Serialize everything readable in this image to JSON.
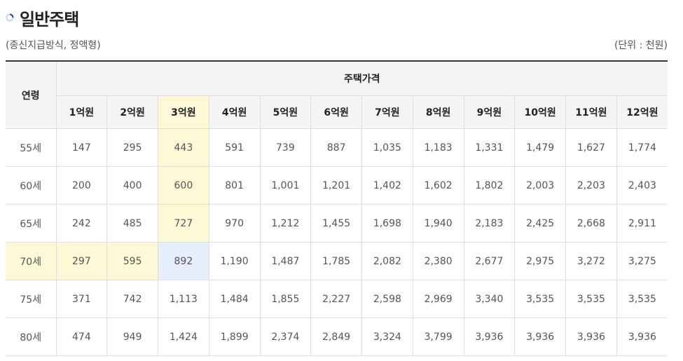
{
  "title": "일반주택",
  "subtitle_left": "(종신지급방식, 정액형)",
  "subtitle_right": "(단위 : 천원)",
  "table": {
    "age_header": "연령",
    "price_header": "주택가격",
    "columns": [
      "1억원",
      "2억원",
      "3억원",
      "4억원",
      "5억원",
      "6억원",
      "7억원",
      "8억원",
      "9억원",
      "10억원",
      "11억원",
      "12억원"
    ],
    "rows": [
      {
        "age": "55세",
        "values": [
          "147",
          "295",
          "443",
          "591",
          "739",
          "887",
          "1,035",
          "1,183",
          "1,331",
          "1,479",
          "1,627",
          "1,774"
        ]
      },
      {
        "age": "60세",
        "values": [
          "200",
          "400",
          "600",
          "801",
          "1,001",
          "1,201",
          "1,402",
          "1,602",
          "1,802",
          "2,003",
          "2,203",
          "2,403"
        ]
      },
      {
        "age": "65세",
        "values": [
          "242",
          "485",
          "727",
          "970",
          "1,212",
          "1,455",
          "1,698",
          "1,940",
          "2,183",
          "2,425",
          "2,668",
          "2,911"
        ]
      },
      {
        "age": "70세",
        "values": [
          "297",
          "595",
          "892",
          "1,190",
          "1,487",
          "1,785",
          "2,082",
          "2,380",
          "2,677",
          "2,975",
          "3,272",
          "3,275"
        ]
      },
      {
        "age": "75세",
        "values": [
          "371",
          "742",
          "1,113",
          "1,484",
          "1,855",
          "2,227",
          "2,598",
          "2,969",
          "3,340",
          "3,535",
          "3,535",
          "3,535"
        ]
      },
      {
        "age": "80세",
        "values": [
          "474",
          "949",
          "1,424",
          "1,899",
          "2,374",
          "2,849",
          "3,324",
          "3,799",
          "3,936",
          "3,936",
          "3,936",
          "3,936"
        ]
      }
    ],
    "highlight_column_index": 2,
    "highlight_row_index": 3
  },
  "colors": {
    "highlight_yellow": "#fdf9d6",
    "highlight_blue": "#e6eefb",
    "header_bg": "#f4f4f4"
  },
  "icons": {
    "title_icon": "circle-bullet-icon"
  }
}
